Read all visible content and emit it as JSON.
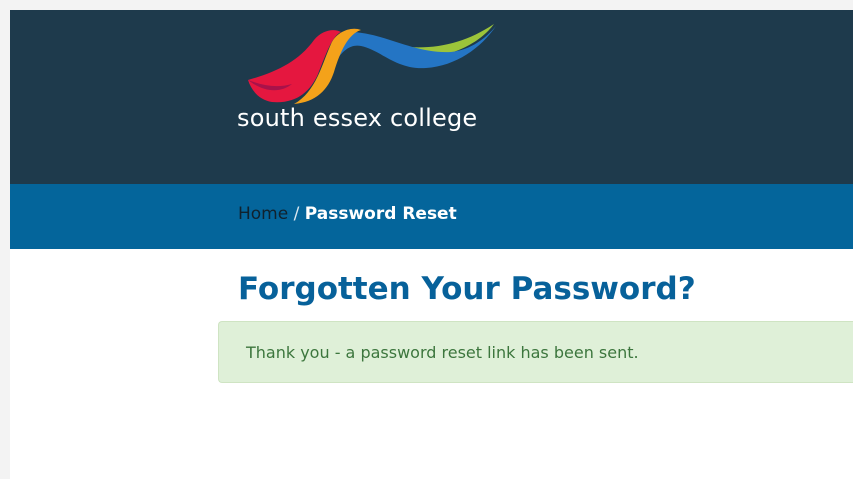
{
  "header": {
    "logo_text": "south essex college"
  },
  "breadcrumb": {
    "home_label": "Home",
    "separator": "/",
    "current_label": "Password Reset"
  },
  "main": {
    "title": "Forgotten Your Password?",
    "alert_message": "Thank you - a password reset link has been sent."
  },
  "colors": {
    "header_bg": "#1e3a4c",
    "breadcrumb_bg": "#04659b",
    "title_color": "#07619a",
    "alert_bg": "#dff0d8",
    "alert_text": "#3c763d",
    "logo_red": "#e5173f",
    "logo_orange": "#f4a21a",
    "logo_blue": "#2475c4",
    "logo_green": "#9cc43a"
  }
}
